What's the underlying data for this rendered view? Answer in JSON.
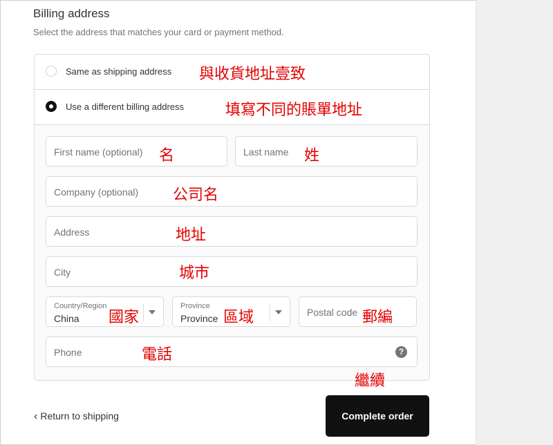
{
  "billing": {
    "title": "Billing address",
    "subtitle": "Select the address that matches your card or payment method.",
    "options": [
      {
        "label": "Same as shipping address",
        "annotation": "與收貨地址壹致",
        "selected": false
      },
      {
        "label": "Use a different billing address",
        "annotation": "填寫不同的賬單地址",
        "selected": true
      }
    ]
  },
  "form": {
    "first_name": {
      "placeholder": "First name (optional)",
      "annotation": "名"
    },
    "last_name": {
      "placeholder": "Last name",
      "annotation": "姓"
    },
    "company": {
      "placeholder": "Company (optional)",
      "annotation": "公司名"
    },
    "address": {
      "placeholder": "Address",
      "annotation": "地址"
    },
    "city": {
      "placeholder": "City",
      "annotation": "城市"
    },
    "country": {
      "label": "Country/Region",
      "value": "China",
      "annotation": "國家"
    },
    "province": {
      "label": "Province",
      "value": "Province",
      "annotation": "區域"
    },
    "postal": {
      "placeholder": "Postal code",
      "annotation": "郵編"
    },
    "phone": {
      "placeholder": "Phone",
      "annotation": "電話",
      "help_icon": "question-circle-icon",
      "help_glyph": "?"
    }
  },
  "footer": {
    "return_label": "Return to shipping",
    "complete_label": "Complete order",
    "complete_annotation": "繼續"
  },
  "colors": {
    "annotation": "#e40000",
    "button": "#111111"
  }
}
